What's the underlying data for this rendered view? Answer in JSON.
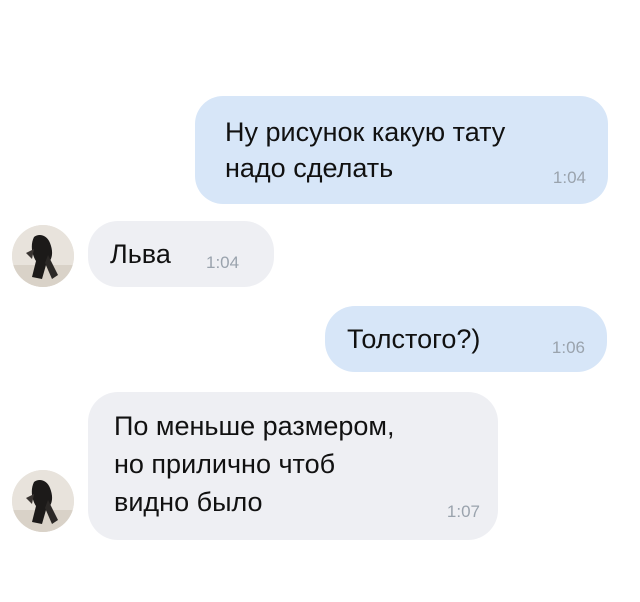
{
  "messages": [
    {
      "direction": "outgoing",
      "text": "Ну рисунок какую тату\nнадо сделать",
      "time": "1:04"
    },
    {
      "direction": "incoming",
      "text": "Льва",
      "time": "1:04",
      "avatar": "contact-avatar"
    },
    {
      "direction": "outgoing",
      "text": "Толстого?)",
      "time": "1:06"
    },
    {
      "direction": "incoming",
      "text": "По меньше размером,\nно прилично чтоб\nвидно было",
      "time": "1:07",
      "avatar": "contact-avatar"
    }
  ],
  "colors": {
    "outgoing_bubble": "#d7e6f8",
    "incoming_bubble": "#eeeff3",
    "time_text": "#9aa3ad",
    "message_text": "#111111"
  }
}
